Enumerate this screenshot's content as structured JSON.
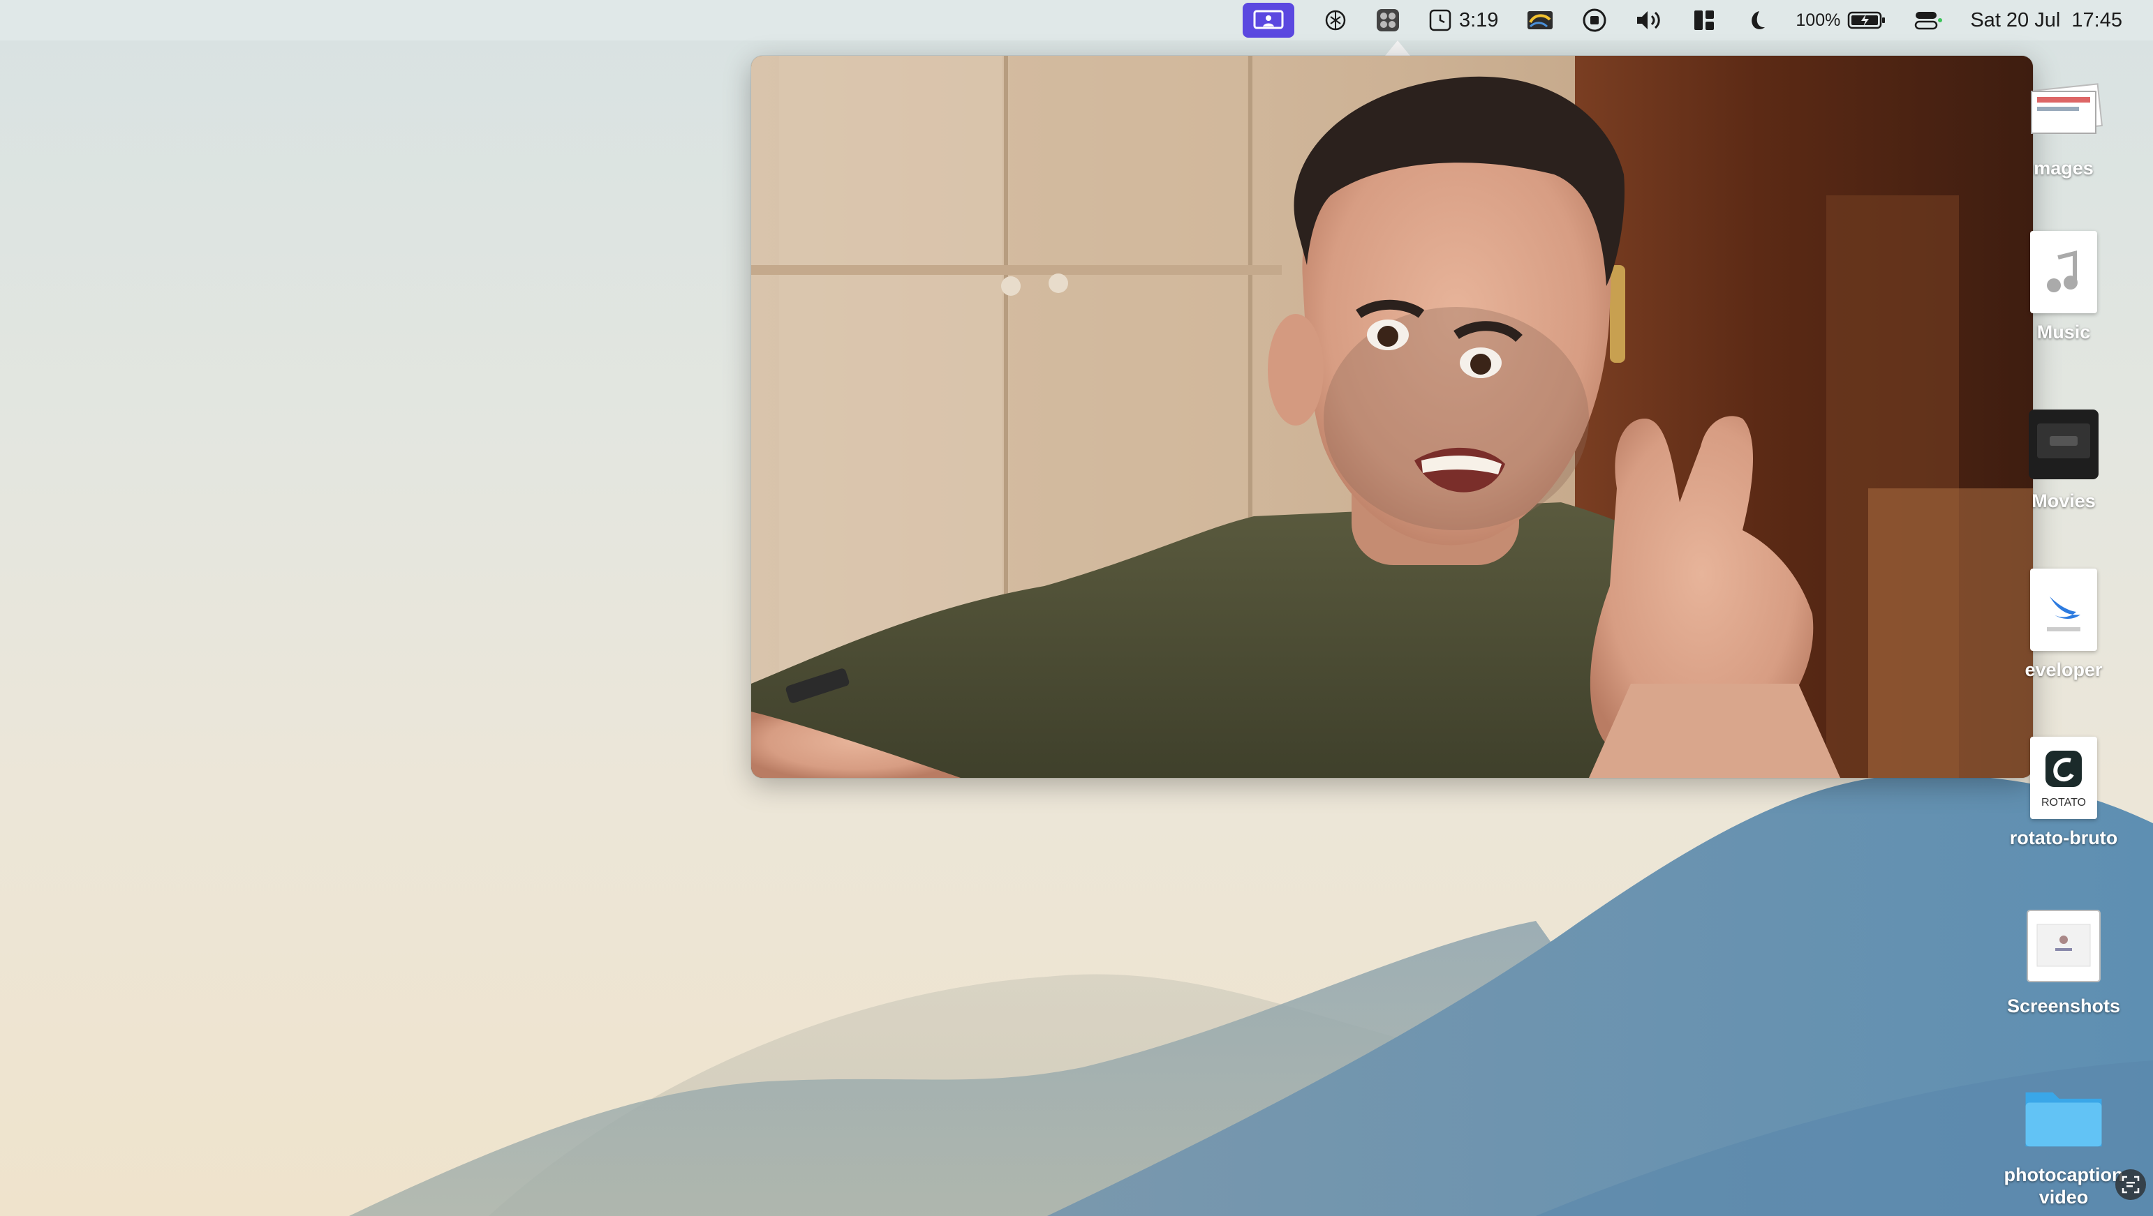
{
  "menubar": {
    "timer": "3:19",
    "battery_percent": "100%",
    "datetime": "Sat 20 Jul  17:45",
    "icons": [
      "screen-share-icon",
      "openai-icon",
      "camera-controls-icon",
      "timer-icon",
      "nvidia-icon",
      "record-stop-icon",
      "volume-icon",
      "window-layout-icon",
      "focus-moon-icon",
      "battery-icon",
      "control-center-icon"
    ],
    "active_color": "#5b48e0"
  },
  "desktop": {
    "items": [
      {
        "label": "mages",
        "icon": "images-folder-icon"
      },
      {
        "label": "Music",
        "icon": "music-folder-icon"
      },
      {
        "label": "Movies",
        "icon": "movies-folder-icon"
      },
      {
        "label": "eveloper",
        "icon": "playground-file-icon"
      },
      {
        "label": "rotato-bruto",
        "icon": "rotato-file-icon",
        "badge": "ROTATO"
      },
      {
        "label": "Screenshots",
        "icon": "screenshots-folder-icon"
      },
      {
        "label": "photocaption video",
        "icon": "folder-icon"
      }
    ]
  },
  "camera": {
    "content": "webcam-preview-image"
  }
}
